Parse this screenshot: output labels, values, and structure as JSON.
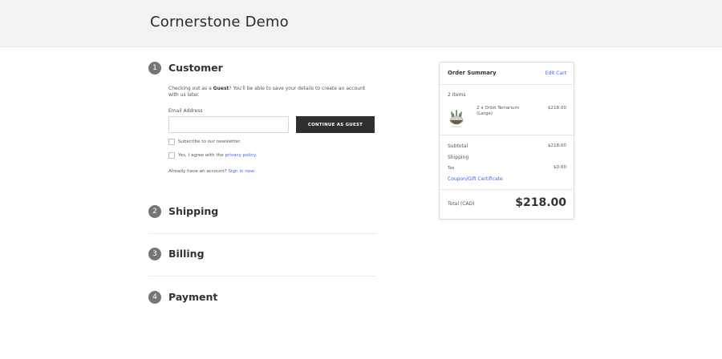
{
  "header": {
    "store_name": "Cornerstone Demo"
  },
  "steps": [
    {
      "number": "1",
      "title": "Customer"
    },
    {
      "number": "2",
      "title": "Shipping"
    },
    {
      "number": "3",
      "title": "Billing"
    },
    {
      "number": "4",
      "title": "Payment"
    }
  ],
  "customer": {
    "info_prefix": "Checking out as a ",
    "info_guest": "Guest",
    "info_suffix": "? You'll be able to save your details to create an account with us later.",
    "email_label": "Email Address",
    "email_value": "",
    "email_placeholder": "",
    "continue_label": "CONTINUE AS GUEST",
    "newsletter_label": "Subscribe to our newsletter.",
    "agree_prefix": "Yes, I agree with the ",
    "agree_link": "privacy policy.",
    "signin_prefix": "Already have an account? ",
    "signin_link": "Sign in now"
  },
  "summary": {
    "title": "Order Summary",
    "edit_cart": "Edit Cart",
    "items_count": "2 Items",
    "item_name": "2 x Orbit Terrarium (Large)",
    "item_price": "$218.00",
    "subtotal_label": "Subtotal",
    "subtotal_value": "$218.00",
    "shipping_label": "Shipping",
    "tax_label": "Tax",
    "tax_value": "$0.00",
    "coupon_label": "Coupon/Gift Certificate",
    "total_label": "Total (CAD)",
    "total_value": "$218.00"
  },
  "icons": {
    "product": "terrarium-image"
  },
  "colors": {
    "link": "#3c64f4",
    "button": "#2f2f2f",
    "badge": "#757575"
  }
}
